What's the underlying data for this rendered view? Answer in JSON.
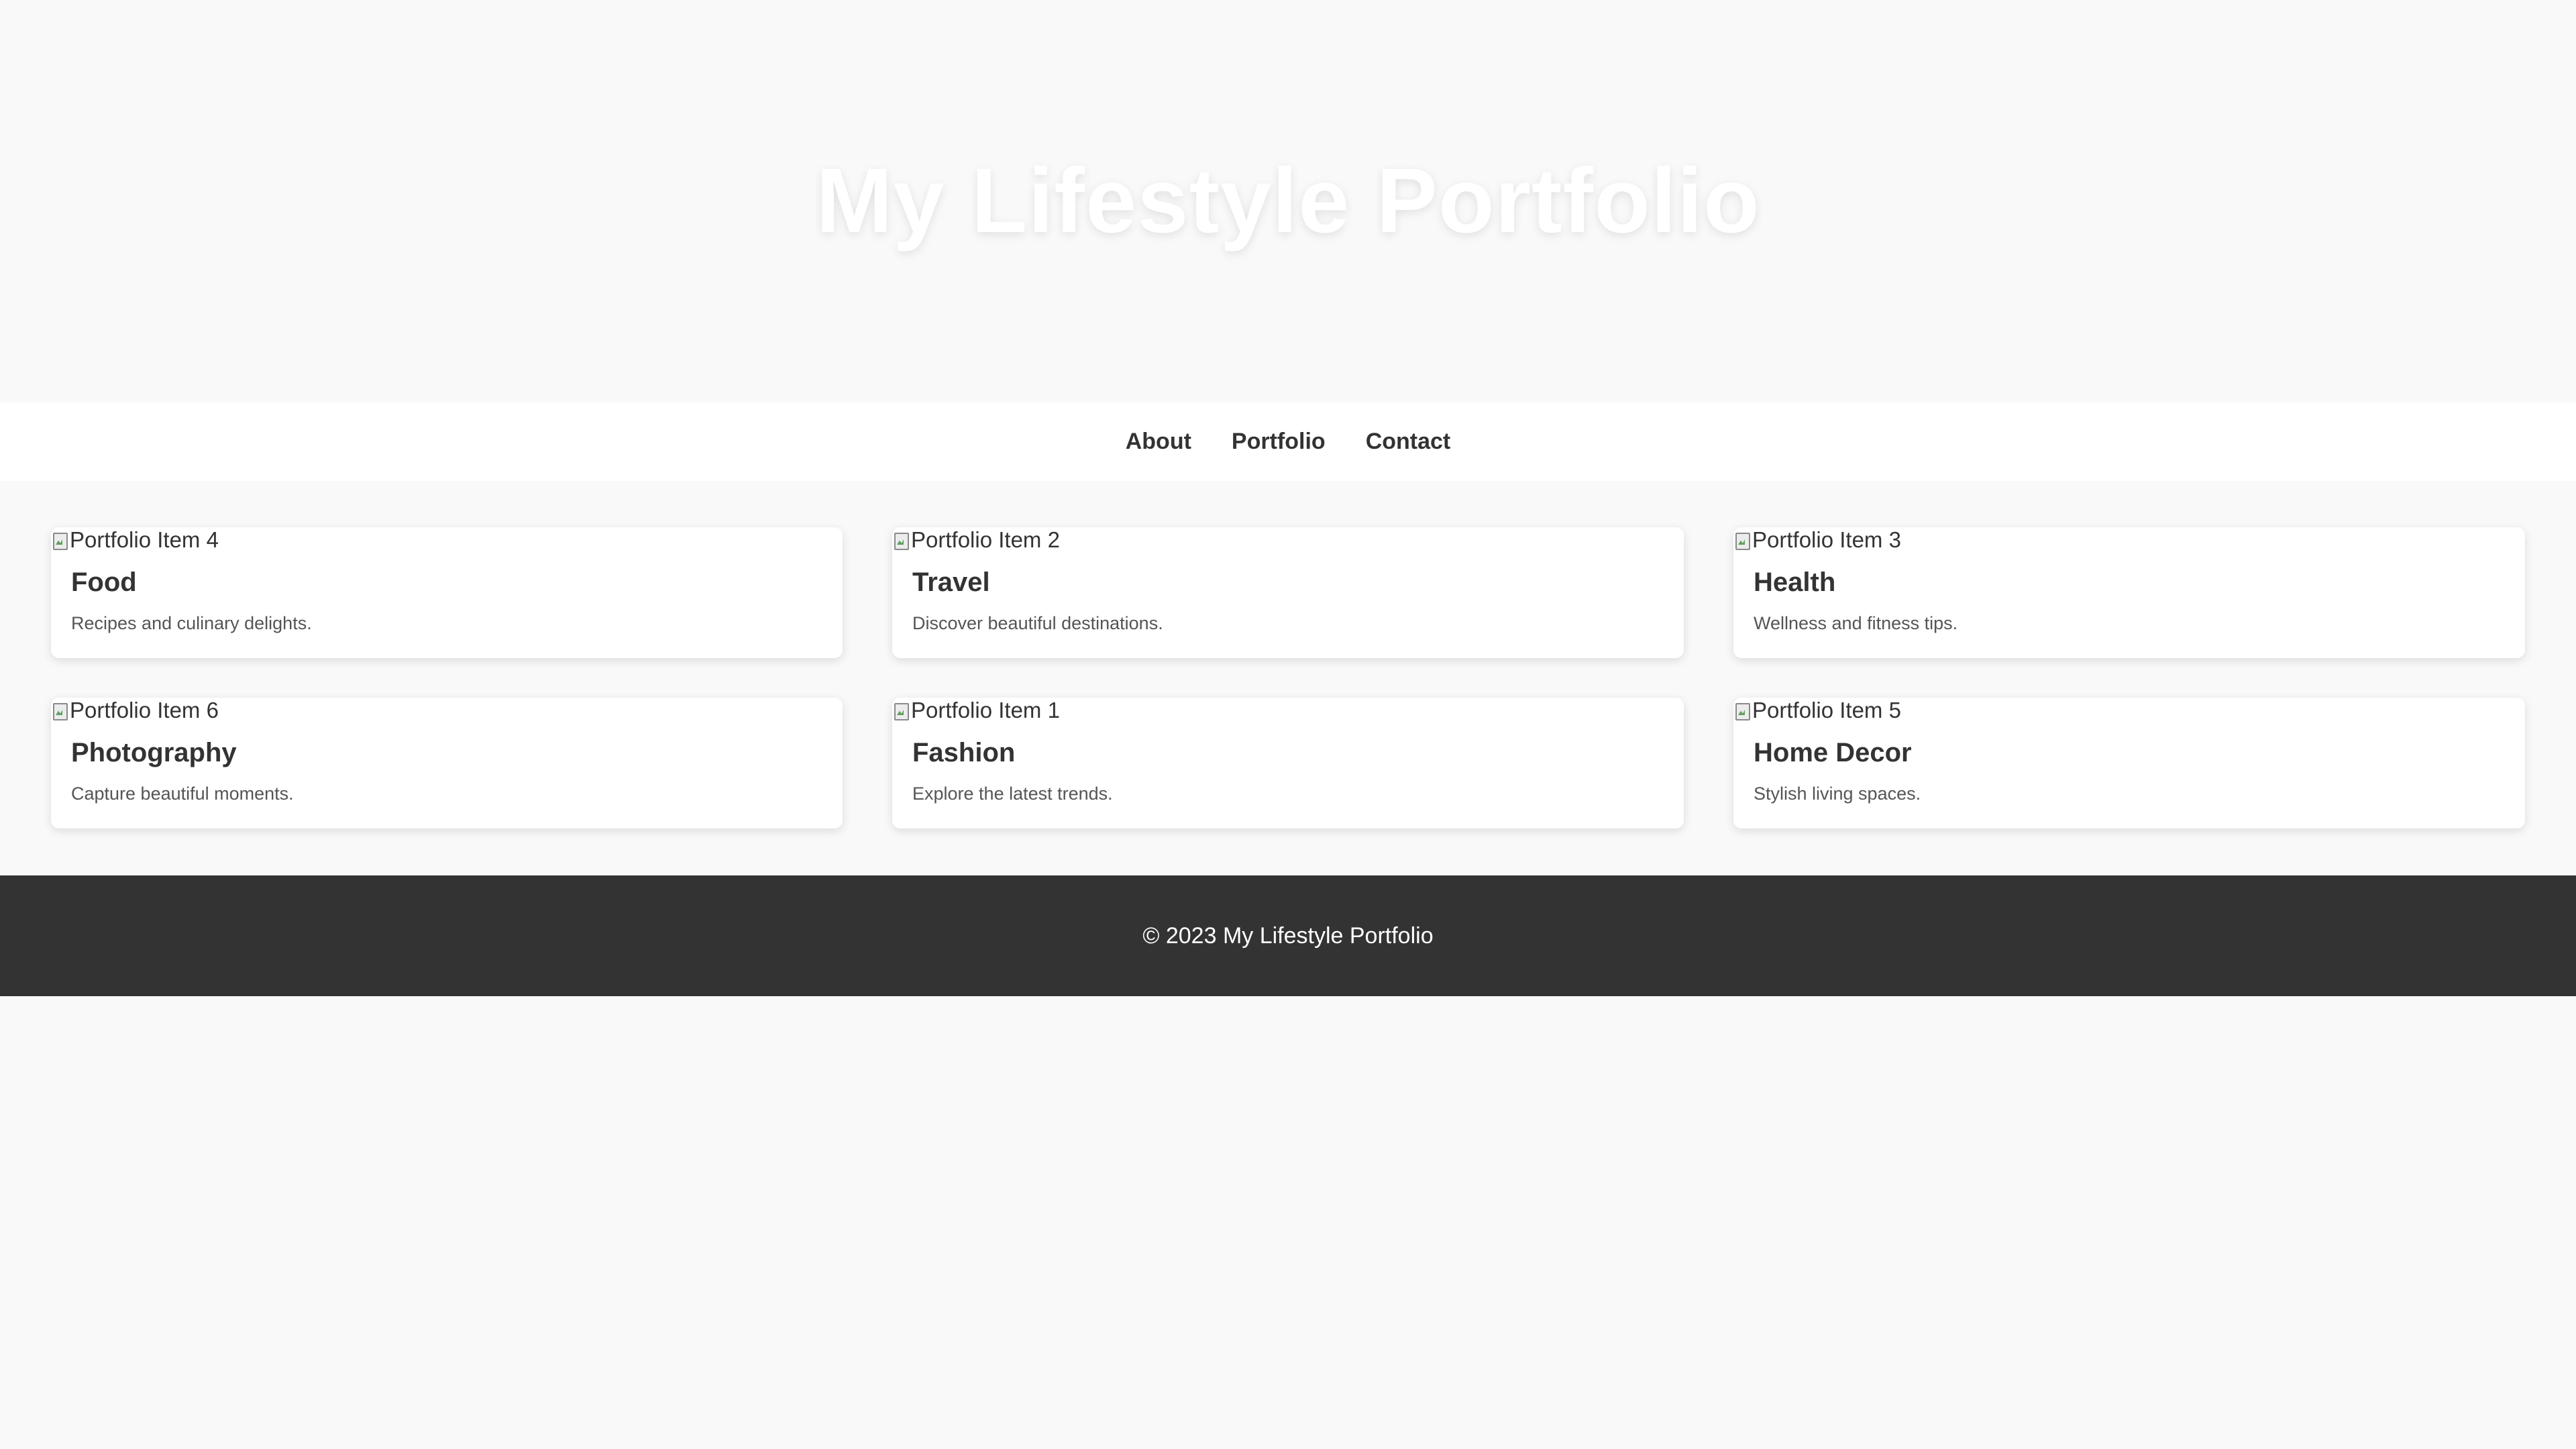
{
  "header": {
    "title": "My Lifestyle Portfolio"
  },
  "nav": {
    "items": [
      "About",
      "Portfolio",
      "Contact"
    ]
  },
  "portfolio": {
    "items": [
      {
        "image_alt": "Portfolio Item 4",
        "title": "Food",
        "description": "Recipes and culinary delights."
      },
      {
        "image_alt": "Portfolio Item 2",
        "title": "Travel",
        "description": "Discover beautiful destinations."
      },
      {
        "image_alt": "Portfolio Item 3",
        "title": "Health",
        "description": "Wellness and fitness tips."
      },
      {
        "image_alt": "Portfolio Item 6",
        "title": "Photography",
        "description": "Capture beautiful moments."
      },
      {
        "image_alt": "Portfolio Item 1",
        "title": "Fashion",
        "description": "Explore the latest trends."
      },
      {
        "image_alt": "Portfolio Item 5",
        "title": "Home Decor",
        "description": "Stylish living spaces."
      }
    ]
  },
  "footer": {
    "text": "© 2023 My Lifestyle Portfolio"
  },
  "colors": {
    "page_background": "#f9f9f9",
    "nav_background": "#ffffff",
    "footer_background": "#333333",
    "text": "#333333",
    "hero_title": "#ffffff"
  },
  "icons": {
    "card_image": "broken-image-icon"
  }
}
